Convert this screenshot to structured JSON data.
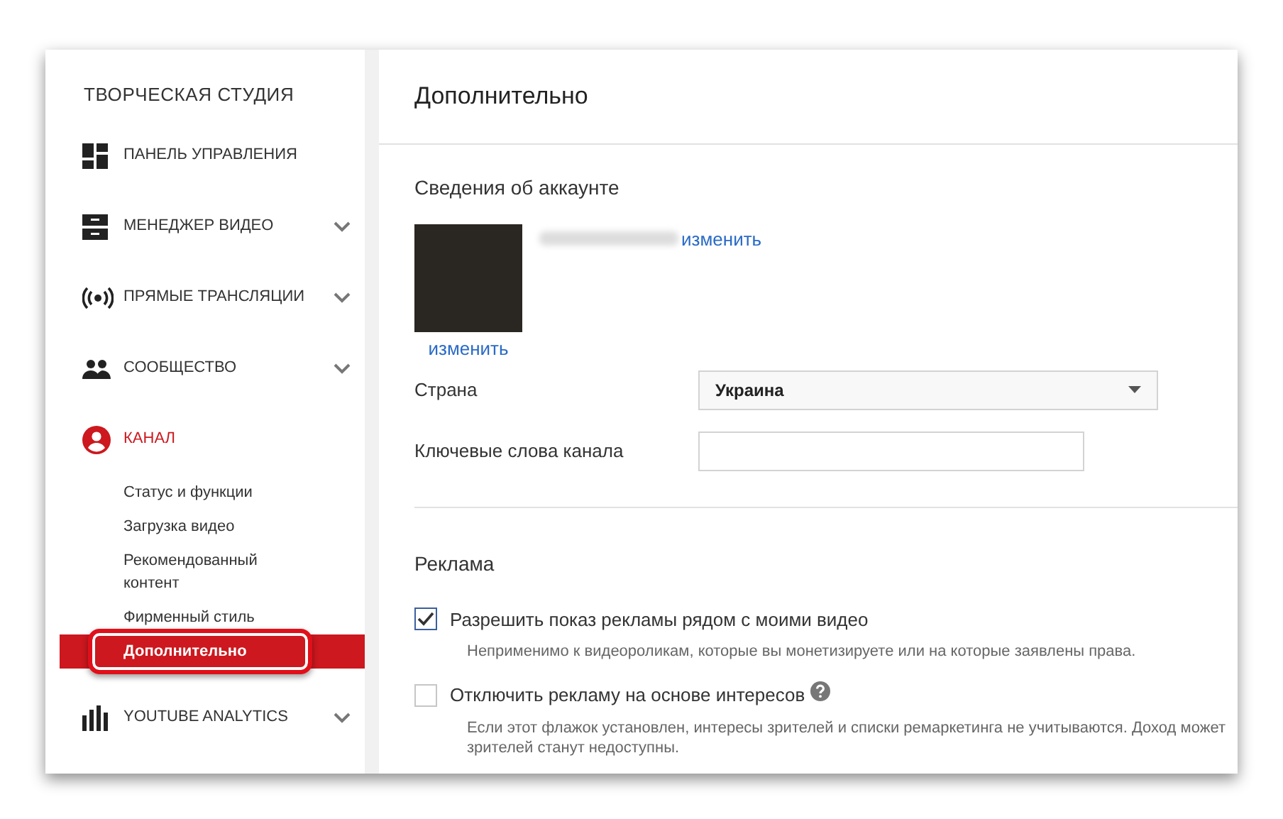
{
  "sidebar": {
    "title": "ТВОРЧЕСКАЯ СТУДИЯ",
    "items": [
      {
        "kind": "dashboard",
        "label": "ПАНЕЛЬ УПРАВЛЕНИЯ",
        "expandable": false,
        "selected": false
      },
      {
        "kind": "video",
        "label": "МЕНЕДЖЕР ВИДЕО",
        "expandable": true,
        "selected": false
      },
      {
        "kind": "live",
        "label": "ПРЯМЫЕ ТРАНСЛЯЦИИ",
        "expandable": true,
        "selected": false
      },
      {
        "kind": "community",
        "label": "СООБЩЕСТВО",
        "expandable": true,
        "selected": false
      },
      {
        "kind": "channel",
        "label": "КАНАЛ",
        "expandable": false,
        "selected": true,
        "children": [
          {
            "label": "Статус и функции",
            "selected": false
          },
          {
            "label": "Загрузка видео",
            "selected": false
          },
          {
            "label": "Рекомендованный контент",
            "selected": false
          },
          {
            "label": "Фирменный стиль",
            "selected": false
          },
          {
            "label": "Дополнительно",
            "selected": true
          }
        ]
      },
      {
        "kind": "analytics",
        "label": "YOUTUBE ANALYTICS",
        "expandable": true,
        "selected": false
      }
    ]
  },
  "page_title": "Дополнительно",
  "account": {
    "heading": "Сведения об аккаунте",
    "name_link": "изменить",
    "avatar_link": "изменить",
    "fields": [
      {
        "kind": "select",
        "label": "Страна",
        "value": "Украина"
      },
      {
        "kind": "text",
        "label": "Ключевые слова канала"
      }
    ]
  },
  "ads": {
    "heading": "Реклама",
    "options": [
      {
        "label": "Разрешить показ рекламы рядом с моими видео",
        "checked": true,
        "help": false,
        "hint_lines": [
          "Неприменимо к видеороликам, которые вы монетизируете или на которые заявлены права."
        ]
      },
      {
        "label": "Отключить рекламу на основе интересов",
        "checked": false,
        "help": true,
        "hint_lines": [
          "Если этот флажок установлен, интересы зрителей и списки ремаркетинга не учитываются. Доход может",
          "зрителей станут недоступны."
        ]
      }
    ]
  }
}
